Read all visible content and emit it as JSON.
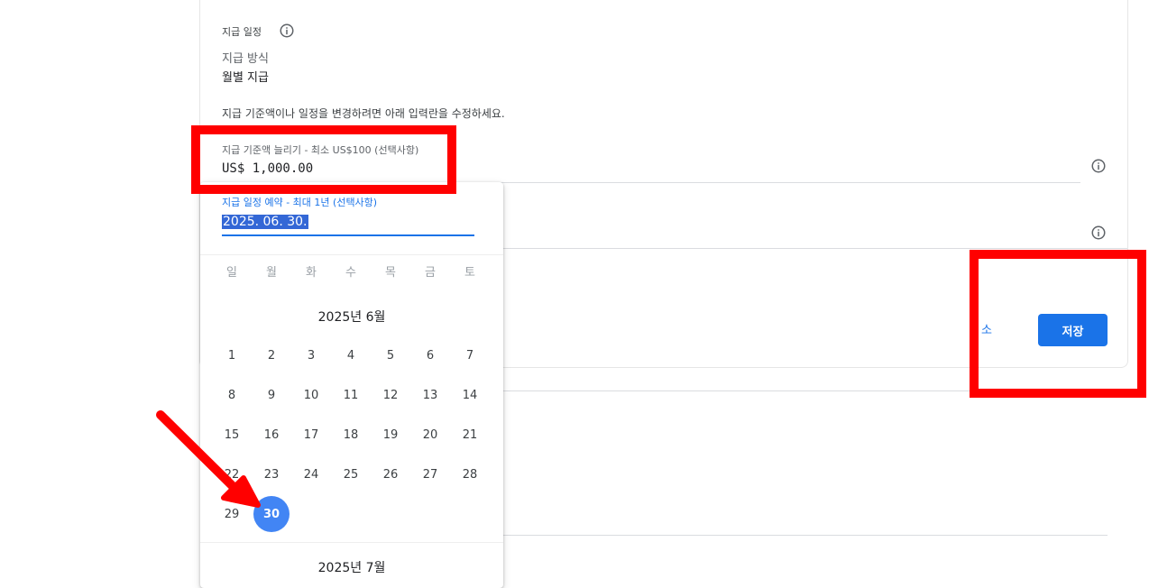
{
  "section": {
    "title": "지급 일정"
  },
  "payment_method": {
    "label": "지급 방식",
    "value": "월별 지급"
  },
  "instruction": "지급 기준액이나 일정을 변경하려면 아래 입력란을 수정하세요.",
  "threshold": {
    "label": "지급 기준액 늘리기 - 최소 US$100 (선택사항)",
    "value": "US$ 1,000.00"
  },
  "schedule": {
    "label": "지급 일정 예약 - 최대 1년 (선택사항)",
    "value": "2025. 06. 30."
  },
  "actions": {
    "cancel": "소",
    "save": "저장"
  },
  "calendar": {
    "weekdays": [
      "일",
      "월",
      "화",
      "수",
      "목",
      "금",
      "토"
    ],
    "month1": "2025년 6월",
    "month2": "2025년 7월",
    "days": [
      "1",
      "2",
      "3",
      "4",
      "5",
      "6",
      "7",
      "8",
      "9",
      "10",
      "11",
      "12",
      "13",
      "14",
      "15",
      "16",
      "17",
      "18",
      "19",
      "20",
      "21",
      "22",
      "23",
      "24",
      "25",
      "26",
      "27",
      "28",
      "29",
      "30"
    ],
    "selected_day": "30"
  },
  "colors": {
    "accent": "#1a73e8",
    "selected": "#4285f4",
    "annotation": "#ff0000"
  },
  "icons": {
    "info": "info-circle-icon"
  }
}
